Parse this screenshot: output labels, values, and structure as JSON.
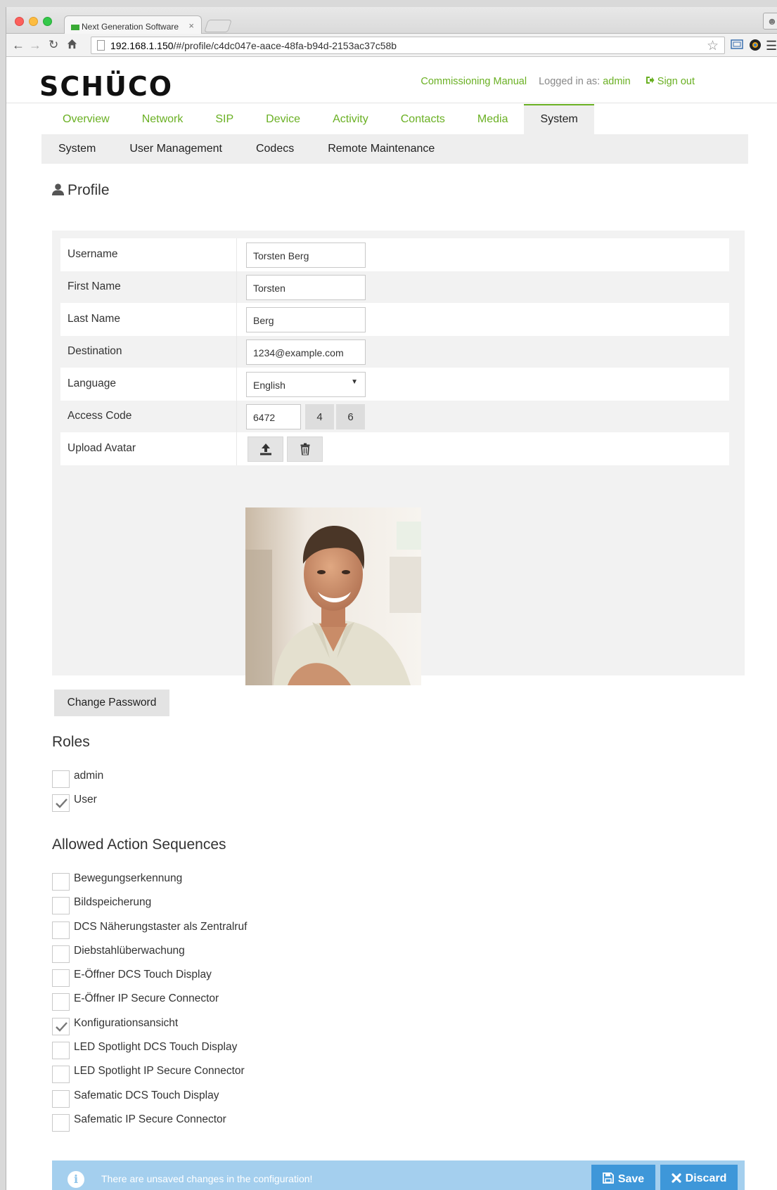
{
  "browser": {
    "tab_title": "Next Generation Software",
    "tab_close": "×",
    "url_host": "192.168.1.150",
    "url_path": "/#/profile/c4dc047e-aace-48fa-b94d-2153ac37c58b"
  },
  "header": {
    "brand": "SCHÜCO",
    "commissioning_manual": "Commissioning Manual",
    "logged_in_as_label": "Logged in as:",
    "username": "admin",
    "sign_out": "Sign out"
  },
  "main_nav": [
    {
      "label": "Overview",
      "active": false
    },
    {
      "label": "Network",
      "active": false
    },
    {
      "label": "SIP",
      "active": false
    },
    {
      "label": "Device",
      "active": false
    },
    {
      "label": "Activity",
      "active": false
    },
    {
      "label": "Contacts",
      "active": false
    },
    {
      "label": "Media",
      "active": false
    },
    {
      "label": "System",
      "active": true
    }
  ],
  "sub_nav": [
    "System",
    "User Management",
    "Codecs",
    "Remote Maintenance"
  ],
  "profile": {
    "title": "Profile",
    "fields": {
      "username": {
        "label": "Username",
        "value": "Torsten Berg"
      },
      "first_name": {
        "label": "First Name",
        "value": "Torsten"
      },
      "last_name": {
        "label": "Last Name",
        "value": "Berg"
      },
      "destination": {
        "label": "Destination",
        "value": "1234@example.com"
      },
      "language": {
        "label": "Language",
        "value": "English"
      },
      "access_code": {
        "label": "Access Code",
        "value": "6472",
        "options": [
          "4",
          "6"
        ]
      },
      "upload_avatar": {
        "label": "Upload Avatar"
      }
    },
    "change_password": "Change Password"
  },
  "roles": {
    "title": "Roles",
    "items": [
      {
        "label": "admin",
        "checked": false
      },
      {
        "label": "User",
        "checked": true
      }
    ]
  },
  "action_sequences": {
    "title": "Allowed Action Sequences",
    "items": [
      {
        "label": "Bewegungserkennung",
        "checked": false
      },
      {
        "label": "Bildspeicherung",
        "checked": false
      },
      {
        "label": "DCS Näherungstaster als Zentralruf",
        "checked": false
      },
      {
        "label": "Diebstahlüberwachung",
        "checked": false
      },
      {
        "label": "E-Öffner DCS Touch Display",
        "checked": false
      },
      {
        "label": "E-Öffner IP Secure Connector",
        "checked": false
      },
      {
        "label": "Konfigurationsansicht",
        "checked": true
      },
      {
        "label": "LED Spotlight DCS Touch Display",
        "checked": false
      },
      {
        "label": "LED Spotlight IP Secure Connector",
        "checked": false
      },
      {
        "label": "Safematic DCS Touch Display",
        "checked": false
      },
      {
        "label": "Safematic IP Secure Connector",
        "checked": false
      }
    ]
  },
  "notice": {
    "message": "There are unsaved changes in the configuration!",
    "save": "Save",
    "discard": "Discard"
  },
  "colors": {
    "brand_green": "#6ab023",
    "notice_bg": "#a4cfee",
    "button_blue": "#3e97d9"
  }
}
